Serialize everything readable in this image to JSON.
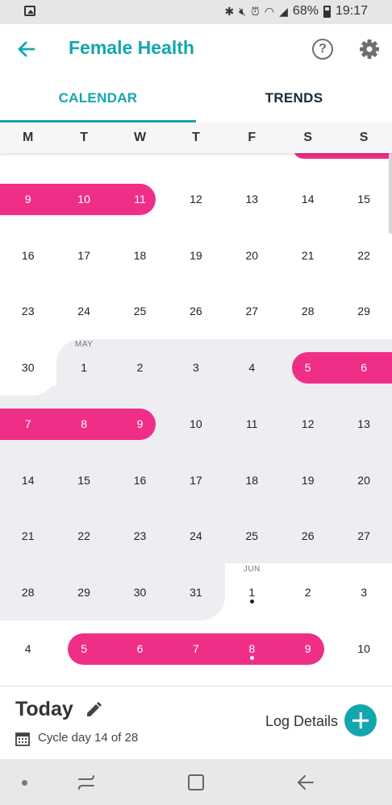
{
  "status_bar": {
    "battery": "68%",
    "time": "19:17"
  },
  "header": {
    "title": "Female Health"
  },
  "tabs": [
    {
      "label": "CALENDAR",
      "active": true
    },
    {
      "label": "TRENDS",
      "active": false
    }
  ],
  "weekdays": [
    "M",
    "T",
    "W",
    "T",
    "F",
    "S",
    "S"
  ],
  "calendar": {
    "weeks": [
      [
        "9",
        "10",
        "11",
        "12",
        "13",
        "14",
        "15"
      ],
      [
        "16",
        "17",
        "18",
        "19",
        "20",
        "21",
        "22"
      ],
      [
        "23",
        "24",
        "25",
        "26",
        "27",
        "28",
        "29"
      ],
      [
        "30",
        "1",
        "2",
        "3",
        "4",
        "5",
        "6"
      ],
      [
        "7",
        "8",
        "9",
        "10",
        "11",
        "12",
        "13"
      ],
      [
        "14",
        "15",
        "16",
        "17",
        "18",
        "19",
        "20"
      ],
      [
        "21",
        "22",
        "23",
        "24",
        "25",
        "26",
        "27"
      ],
      [
        "28",
        "29",
        "30",
        "31",
        "1",
        "2",
        "3"
      ],
      [
        "4",
        "5",
        "6",
        "7",
        "8",
        "9",
        "10"
      ]
    ],
    "month_labels": {
      "may": "MAY",
      "jun": "JUN"
    },
    "accent_pink": "#ef2f87",
    "accent_teal": "#13a6ae"
  },
  "today_panel": {
    "title": "Today",
    "cycle_text": "Cycle day 14 of 28",
    "log_label": "Log Details"
  },
  "icons": [
    "back-arrow-icon",
    "help-icon",
    "gear-icon",
    "pencil-icon",
    "calendar-icon",
    "plus-icon"
  ]
}
